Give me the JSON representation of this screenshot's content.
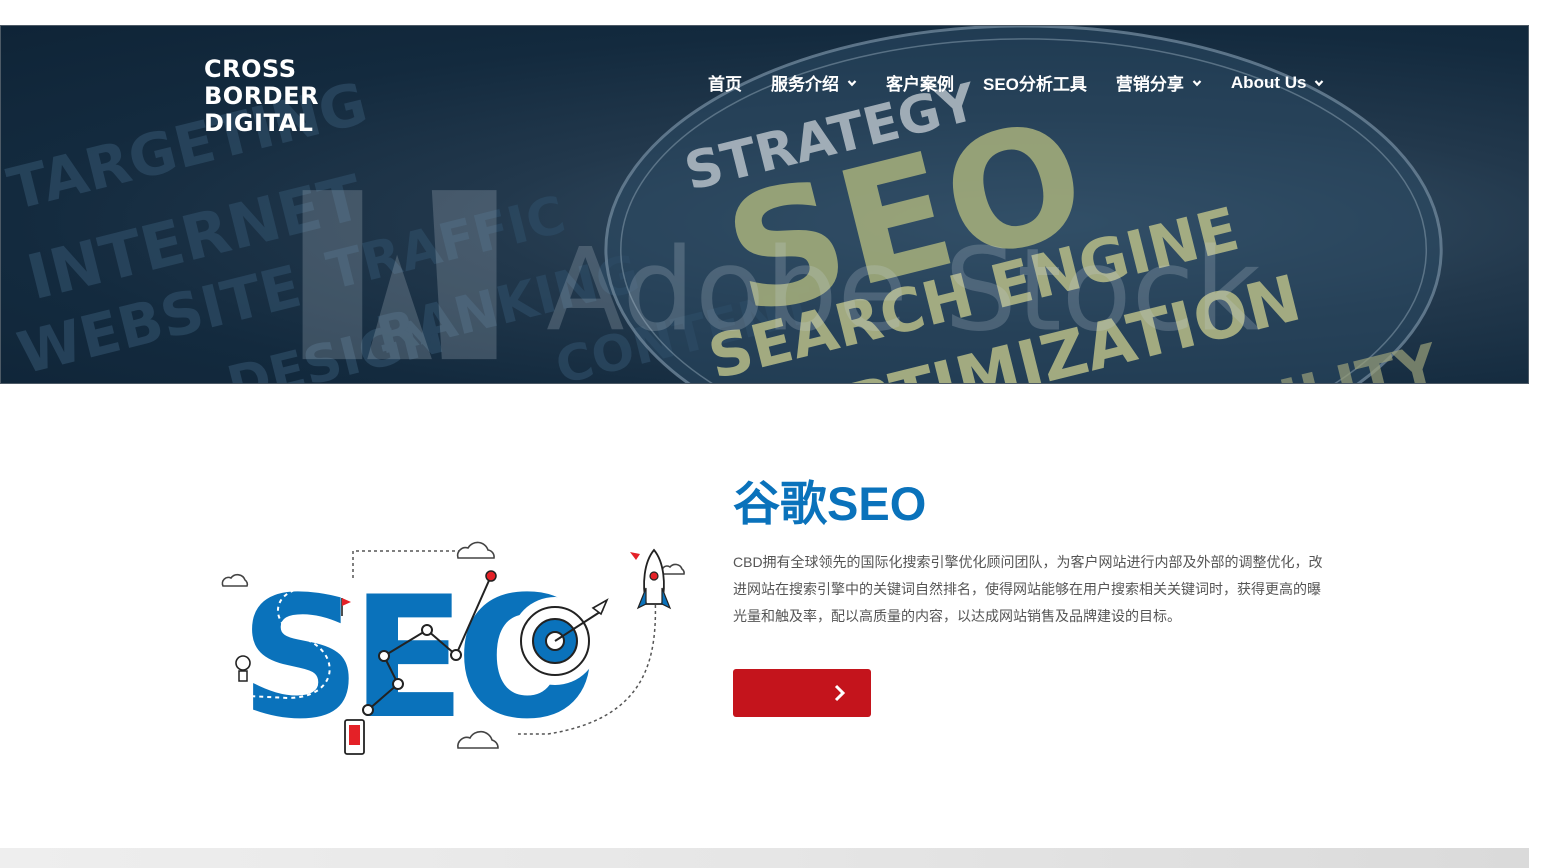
{
  "header": {
    "logo_lines": [
      "CROSS",
      "BORDER",
      "DIGITAL"
    ],
    "nav": [
      {
        "label": "首页",
        "has_dropdown": false
      },
      {
        "label": "服务介绍",
        "has_dropdown": true
      },
      {
        "label": "客户案例",
        "has_dropdown": false
      },
      {
        "label": "SEO分析工具",
        "has_dropdown": false
      },
      {
        "label": "营销分享",
        "has_dropdown": true
      },
      {
        "label": "About Us",
        "has_dropdown": true
      }
    ]
  },
  "hero": {
    "words": [
      "SEO",
      "SEARCH ENGINE",
      "OPTIMIZATION",
      "STRATEGY",
      "WEBSITE",
      "INTERNET",
      "TARGETING",
      "TRAFFIC",
      "DESIGN",
      "RANKING",
      "CONTENT",
      "VISIBILITY",
      "Adobe Stock"
    ]
  },
  "main": {
    "title": "谷歌SEO",
    "description": "CBD拥有全球领先的国际化搜索引擎优化顾问团队，为客户网站进行内部及外部的调整优化，改进网站在搜索引擎中的关键词自然排名，使得网站能够在用户搜索相关关键词时，获得更高的曝光量和触及率，配以高质量的内容，以达成网站销售及品牌建设的目标。",
    "cta_icon": "chevron-right-icon",
    "illustration_text": "SEO"
  },
  "colors": {
    "brand_blue": "#0a72bb",
    "cta_red": "#c4141c",
    "hero_dark": "#132a3e"
  }
}
